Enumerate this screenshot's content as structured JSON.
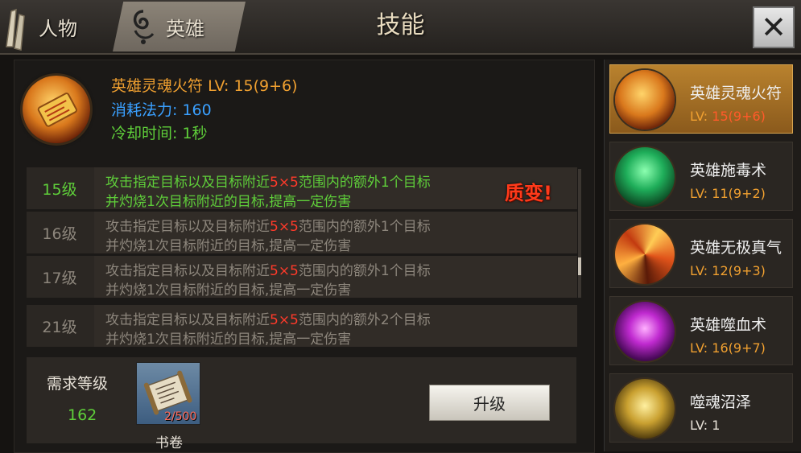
{
  "tabs": [
    {
      "label": "人物"
    },
    {
      "label": "英雄"
    }
  ],
  "title": "技能",
  "selected_skill": {
    "name": "英雄灵魂火符",
    "level_label": "LV: ",
    "level_value": "15(9+6)",
    "cost_label": "消耗法力: ",
    "cost_value": "160",
    "cooldown_label": "冷却时间: ",
    "cooldown_value": "1秒"
  },
  "levels": [
    {
      "level": "15级",
      "line1_pre": "攻击指定目标以及目标附近",
      "line1_hl": "5×5",
      "line1_post": "范围内的额外1个目标",
      "line2": "并灼烧1次目标附近的目标,提高一定伤害"
    },
    {
      "level": "16级",
      "line1_pre": "攻击指定目标以及目标附近",
      "line1_hl": "5×5",
      "line1_post": "范围内的额外1个目标",
      "line2": "并灼烧1次目标附近的目标,提高一定伤害"
    },
    {
      "level": "17级",
      "line1_pre": "攻击指定目标以及目标附近",
      "line1_hl": "5×5",
      "line1_post": "范围内的额外1个目标",
      "line2": "并灼烧1次目标附近的目标,提高一定伤害"
    },
    {
      "level": "21级",
      "line1_pre": "攻击指定目标以及目标附近",
      "line1_hl": "5×5",
      "line1_post": "范围内的额外2个目标",
      "line2": "并灼烧1次目标附近的目标,提高一定伤害"
    }
  ],
  "mutation_badge": "质变!",
  "requirement": {
    "label": "需求等级",
    "value": "162",
    "book_count": "2/500",
    "book_label": "书卷"
  },
  "upgrade_label": "升级",
  "skill_list": [
    {
      "name": "英雄灵魂火符",
      "lv_prefix": "LV: ",
      "lv_value": "15(9+6)",
      "icon": "fire-talisman-icon"
    },
    {
      "name": "英雄施毒术",
      "lv_prefix": "LV: ",
      "lv_value": "11(9+2)",
      "icon": "poison-skull-icon"
    },
    {
      "name": "英雄无极真气",
      "lv_prefix": "LV: ",
      "lv_value": "12(9+3)",
      "icon": "fire-swirl-icon"
    },
    {
      "name": "英雄噬血术",
      "lv_prefix": "LV: ",
      "lv_value": "16(9+7)",
      "icon": "blood-demon-icon"
    },
    {
      "name": "噬魂沼泽",
      "lv_prefix": "LV: ",
      "lv_value": "1",
      "icon": "soul-swamp-icon"
    }
  ],
  "colors": {
    "orange": "#f0a030",
    "blue": "#3aa0ff",
    "green": "#5fcf3a",
    "red_hl": "#ff3a2a",
    "gray_text": "#8d867c"
  }
}
